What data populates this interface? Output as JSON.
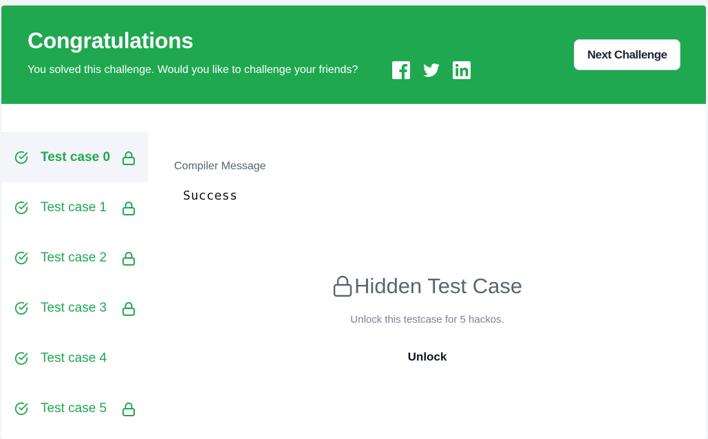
{
  "banner": {
    "title": "Congratulations",
    "subtitle": "You solved this challenge. Would you like to challenge your friends?",
    "next_button": "Next Challenge",
    "social_icons": [
      "facebook-icon",
      "twitter-icon",
      "linkedin-icon"
    ],
    "background_color": "#1fa84f"
  },
  "testcases": [
    {
      "label": "Test case 0",
      "active": true,
      "locked": true
    },
    {
      "label": "Test case 1",
      "active": false,
      "locked": true
    },
    {
      "label": "Test case 2",
      "active": false,
      "locked": true
    },
    {
      "label": "Test case 3",
      "active": false,
      "locked": true
    },
    {
      "label": "Test case 4",
      "active": false,
      "locked": false
    },
    {
      "label": "Test case 5",
      "active": false,
      "locked": true
    }
  ],
  "compiler": {
    "label": "Compiler Message",
    "value": "Success"
  },
  "hidden": {
    "title": "Hidden Test Case",
    "description": "Unlock this testcase for 5 hackos.",
    "unlock_label": "Unlock"
  },
  "colors": {
    "accent": "#1fa84f",
    "active_tab_bg": "#f3f5fb"
  }
}
